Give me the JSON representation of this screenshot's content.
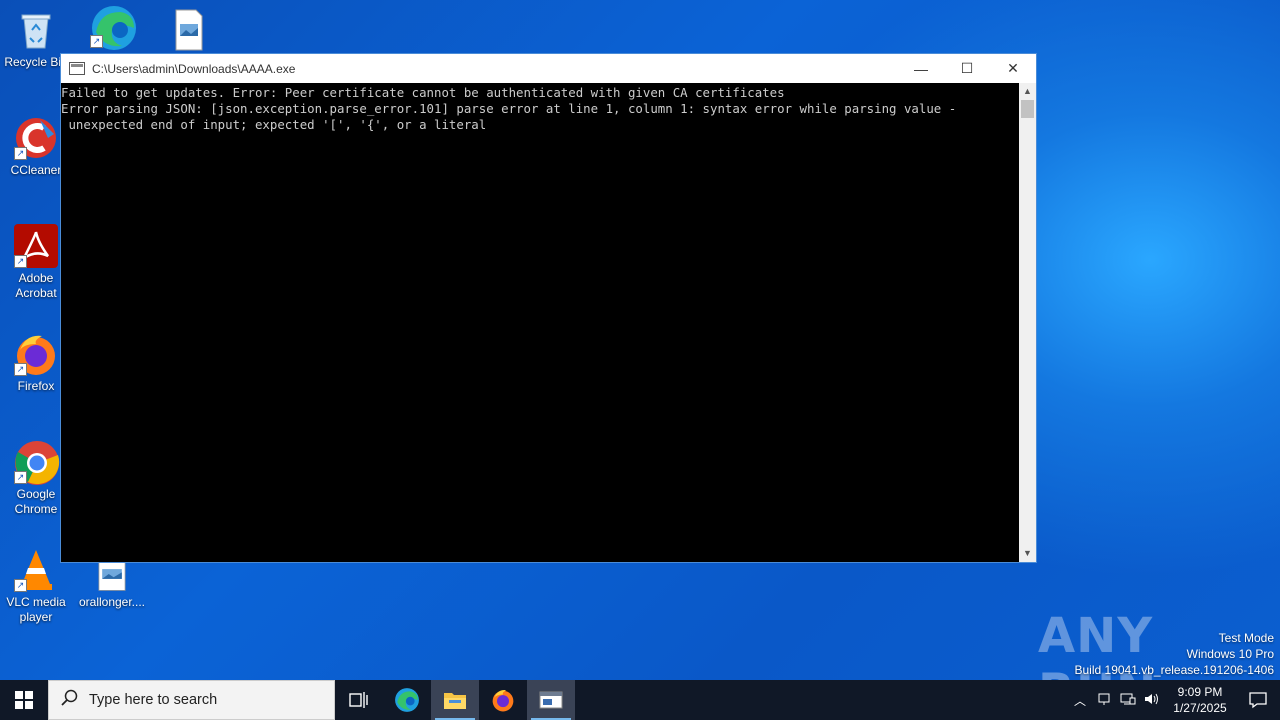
{
  "desktop": {
    "icons": [
      {
        "label": "Recycle Bin",
        "icon": "recycle-bin-icon"
      },
      {
        "label": "",
        "icon": "edge-icon"
      },
      {
        "label": "",
        "icon": "image-file-icon"
      },
      {
        "label": "CCleaner",
        "icon": "ccleaner-icon"
      },
      {
        "label": "Adobe Acrobat",
        "icon": "acrobat-icon"
      },
      {
        "label": "Firefox",
        "icon": "firefox-icon"
      },
      {
        "label": "Google Chrome",
        "icon": "chrome-icon"
      },
      {
        "label": "VLC media player",
        "icon": "vlc-icon"
      },
      {
        "label": "orallonger....",
        "icon": "image-file-icon"
      }
    ]
  },
  "window": {
    "title": "C:\\Users\\admin\\Downloads\\AAAA.exe",
    "minimize": "—",
    "maximize": "☐",
    "close": "✕",
    "lines": [
      "Failed to get updates. Error: Peer certificate cannot be authenticated with given CA certificates",
      "Error parsing JSON: [json.exception.parse_error.101] parse error at line 1, column 1: syntax error while parsing value -",
      " unexpected end of input; expected '[', '{', or a literal"
    ]
  },
  "taskbar": {
    "search_placeholder": "Type here to search",
    "time": "9:09 PM",
    "date": "1/27/2025"
  },
  "watermark": {
    "brand": "ANY RUN",
    "line1": "Test Mode",
    "line2": "Windows 10 Pro",
    "line3": "Build 19041.vb_release.191206-1406"
  },
  "colors": {
    "console_bg": "#000000",
    "console_fg": "#cccccc",
    "taskbar_bg": "#101827"
  }
}
